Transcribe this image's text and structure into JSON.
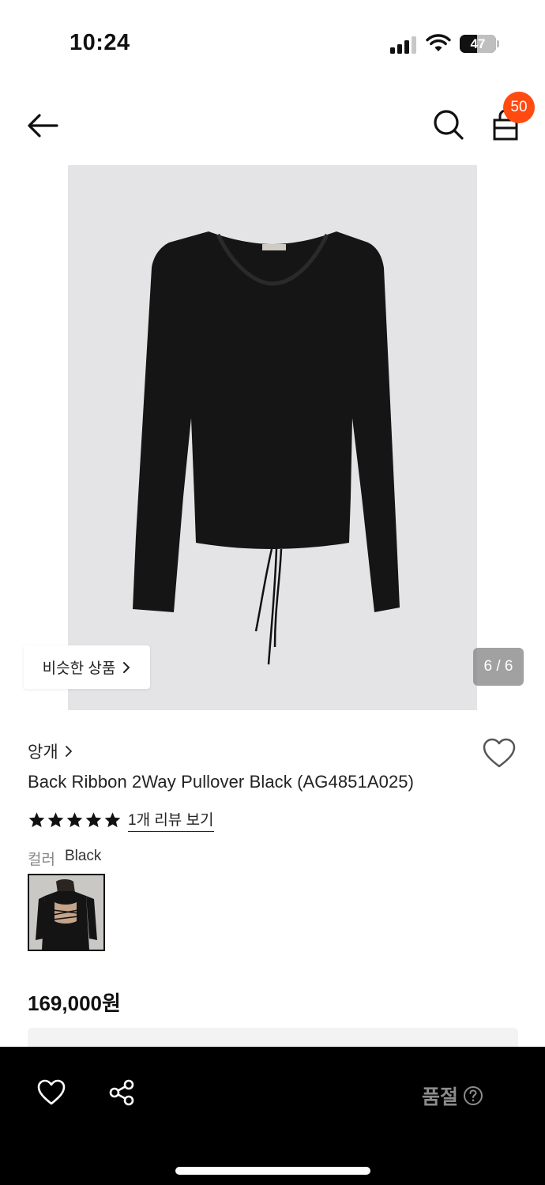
{
  "status": {
    "time": "10:24",
    "battery": "47",
    "battery_level": 0.47
  },
  "nav": {
    "cart_count": "50"
  },
  "gallery": {
    "similar_label": "비슷한 상품",
    "page_indicator": "6 / 6"
  },
  "product": {
    "brand": "앙개",
    "name": "Back Ribbon 2Way Pullover Black (AG4851A025)",
    "rating": 5,
    "review_link": "1개 리뷰 보기",
    "color_label": "컬러",
    "color_value": "Black",
    "price": "169,000원"
  },
  "bottom": {
    "status_label": "품절"
  },
  "colors": {
    "badge": "#ff4b11",
    "hero_bg": "#e4e4e6",
    "bottom_bg": "#000000",
    "soldout_text": "#8c8c8c"
  },
  "icons": [
    "back-arrow-icon",
    "search-icon",
    "shopping-bag-icon",
    "chevron-right-icon",
    "heart-icon",
    "star-icon",
    "share-icon",
    "help-circle-icon"
  ]
}
